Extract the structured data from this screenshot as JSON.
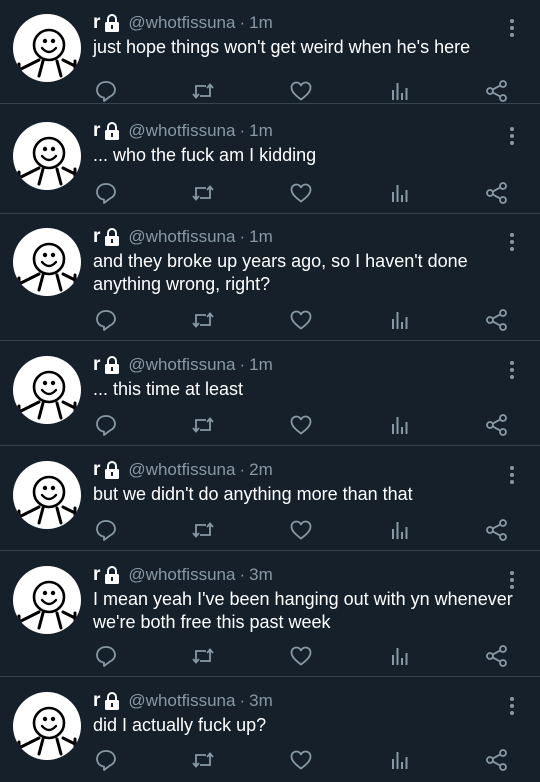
{
  "tweets": [
    {
      "display_name": "r",
      "handle": "@whotfissuna",
      "separator": "·",
      "time": "1m",
      "text": "just hope things won't get weird when he's here"
    },
    {
      "display_name": "r",
      "handle": "@whotfissuna",
      "separator": "·",
      "time": "1m",
      "text": "... who the fuck am I kidding"
    },
    {
      "display_name": "r",
      "handle": "@whotfissuna",
      "separator": "·",
      "time": "1m",
      "text": "and they broke up years ago, so I haven't done anything wrong, right?"
    },
    {
      "display_name": "r",
      "handle": "@whotfissuna",
      "separator": "·",
      "time": "1m",
      "text": "... this time at least"
    },
    {
      "display_name": "r",
      "handle": "@whotfissuna",
      "separator": "·",
      "time": "2m",
      "text": "but we didn't do anything more than that"
    },
    {
      "display_name": "r",
      "handle": "@whotfissuna",
      "separator": "·",
      "time": "3m",
      "text": "I mean yeah I've been hanging out with yn whenever we're both free this past week"
    },
    {
      "display_name": "r",
      "handle": "@whotfissuna",
      "separator": "·",
      "time": "3m",
      "text": "did I actually fuck up?"
    }
  ],
  "icons": {
    "reply": "reply-icon",
    "retweet": "retweet-icon",
    "like": "heart-icon",
    "analytics": "analytics-icon",
    "share": "share-icon",
    "more": "more-icon",
    "lock": "lock-icon"
  },
  "colors": {
    "background": "#15202b",
    "divider": "#38444d",
    "secondary_text": "#8899a6",
    "primary_text": "#ffffff"
  }
}
